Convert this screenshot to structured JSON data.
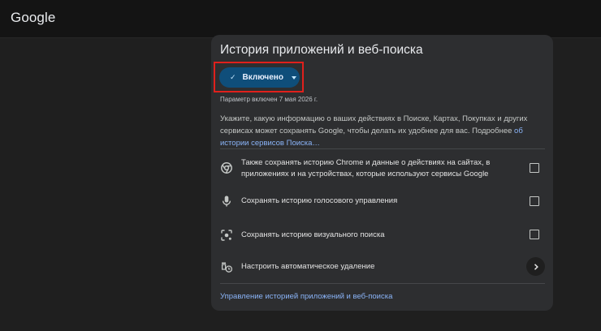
{
  "header": {
    "logo_text": "Google"
  },
  "card": {
    "title": "История приложений и веб-поиска",
    "toggle": {
      "label": "Включено",
      "check_icon": "check-icon",
      "caret_icon": "caret-down-icon",
      "accent": "#0f4e7a"
    },
    "param_note": "Параметр включен 7 мая 2026 г.",
    "description": {
      "text": "Укажите, какую информацию о ваших действиях в Поиске, Картах, Покупках и других сервисах может сохранять Google, чтобы делать их удобнее для вас. Подробнее ",
      "link": "об истории сервисов Поиска…"
    },
    "options": [
      {
        "icon": "chrome-icon",
        "label": "Также сохранять историю Chrome и данные о действиях на сайтах, в приложениях и на устройствах, которые используют сервисы Google",
        "checked": false
      },
      {
        "icon": "microphone-icon",
        "label": "Сохранять историю голосового управления",
        "checked": false
      },
      {
        "icon": "visual-search-icon",
        "label": "Сохранять историю визуального поиска",
        "checked": false
      }
    ],
    "auto_delete": {
      "icon": "auto-delete-icon",
      "label": "Настроить автоматическое удаление",
      "chevron_icon": "chevron-right-icon"
    },
    "footer_link": "Управление историей приложений и веб-поиска"
  }
}
